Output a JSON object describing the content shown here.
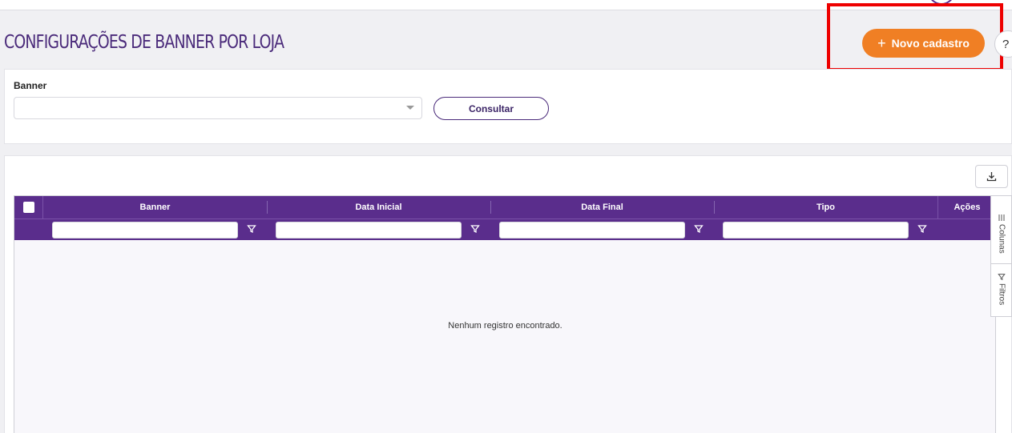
{
  "page": {
    "title": "CONFIGURAÇÕES DE BANNER POR LOJA",
    "new_button_label": "Novo cadastro",
    "help_label": "?"
  },
  "filter": {
    "banner_label": "Banner",
    "banner_value": "",
    "consult_label": "Consultar"
  },
  "grid": {
    "columns": [
      "Banner",
      "Data Inicial",
      "Data Final",
      "Tipo",
      "Ações"
    ],
    "empty_message": "Nenhum registro encontrado.",
    "side_tabs": [
      "Colunas",
      "Filtros"
    ]
  },
  "colors": {
    "header_purple": "#5a2d8c",
    "accent_orange": "#f07f24",
    "title_purple": "#4a2a7a",
    "highlight_red": "#ee0000"
  }
}
